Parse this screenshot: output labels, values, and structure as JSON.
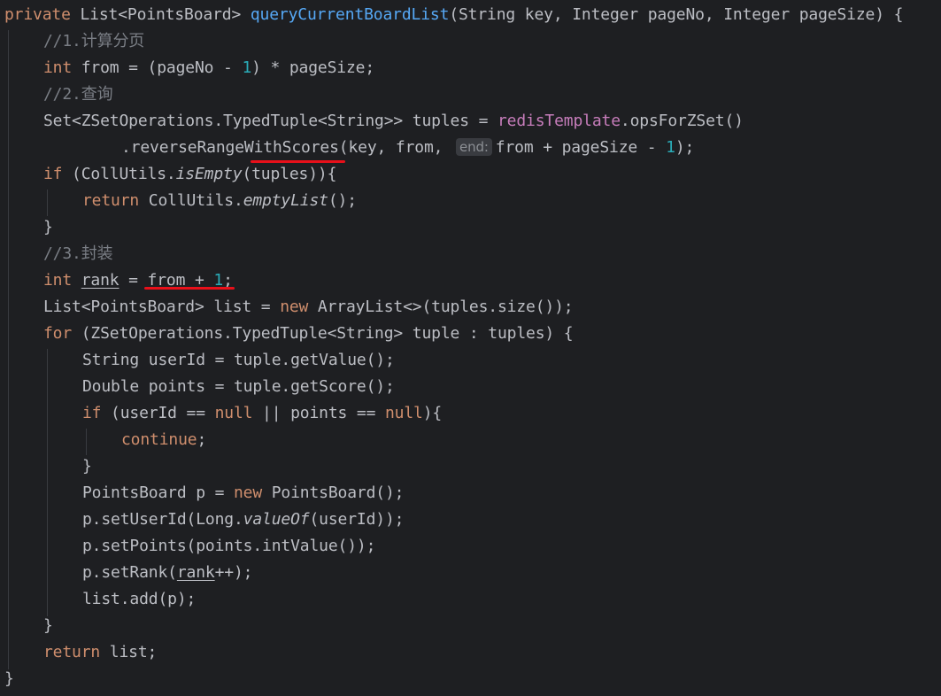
{
  "code": {
    "l1": {
      "kw_private": "private",
      "type": "List<PointsBoard>",
      "method": "queryCurrentBoardList",
      "params": "(String key, Integer pageNo, Integer pageSize) {"
    },
    "l2": {
      "comment": "//1.计算分页"
    },
    "l3": {
      "kw_int": "int",
      "a": " from = (pageNo - ",
      "n1": "1",
      "b": ") * pageSize;"
    },
    "l4": {
      "comment": "//2.查询"
    },
    "l5": {
      "a": "Set<ZSetOperations.TypedTuple<String>> tuples = ",
      "field": "redisTemplate",
      "b": ".opsForZSet()"
    },
    "l6": {
      "a": ".reverseRangeWithScores(key, from,",
      "hint": "end:",
      "b": "from + pageSize - ",
      "n1": "1",
      "c": ");"
    },
    "l7": {
      "kw_if": "if",
      "a": " (CollUtils.",
      "m": "isEmpty",
      "b": "(tuples)){"
    },
    "l8": {
      "kw_return": "return",
      "a": " CollUtils.",
      "m": "emptyList",
      "b": "();"
    },
    "l9": {
      "a": "}"
    },
    "l10": {
      "comment": "//3.封装"
    },
    "l11": {
      "kw_int": "int",
      "sp": " ",
      "var": "rank",
      "a": " = from + ",
      "n1": "1",
      "b": ";"
    },
    "l12": {
      "a": "List<PointsBoard> list = ",
      "kw_new": "new",
      "b": " ArrayList<>(tuples.size());"
    },
    "l13": {
      "kw_for": "for",
      "a": " (ZSetOperations.TypedTuple<String> tuple : tuples) {"
    },
    "l14": {
      "a": "String userId = tuple.getValue();"
    },
    "l15": {
      "a": "Double points = tuple.getScore();"
    },
    "l16": {
      "kw_if": "if",
      "a": " (userId == ",
      "kw_null1": "null",
      "b": " || points == ",
      "kw_null2": "null",
      "c": "){"
    },
    "l17": {
      "kw_continue": "continue",
      "a": ";"
    },
    "l18": {
      "a": "}"
    },
    "l19": {
      "a": "PointsBoard p = ",
      "kw_new": "new",
      "b": " PointsBoard();"
    },
    "l20": {
      "a": "p.setUserId(Long.",
      "m": "valueOf",
      "b": "(userId));"
    },
    "l21": {
      "a": "p.setPoints(points.intValue());"
    },
    "l22": {
      "a": "p.setRank(",
      "var": "rank",
      "b": "++);"
    },
    "l23": {
      "a": "list.add(p);"
    },
    "l24": {
      "a": "}"
    },
    "l25": {
      "kw_return": "return",
      "a": " list;"
    },
    "l26": {
      "a": "}"
    }
  },
  "colors": {
    "background": "#1e1f22",
    "text": "#bcbec4",
    "keyword": "#cf8e6d",
    "method_decl": "#56a8f5",
    "field": "#c77dbb",
    "number": "#2aacb8",
    "comment": "#7a7e85",
    "annotation_underline": "#e8101a"
  }
}
